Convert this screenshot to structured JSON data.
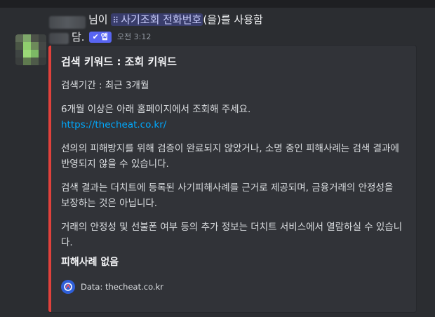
{
  "message": {
    "line1_prefix": "님이",
    "command_icon": "⠿",
    "command_name": "사기조회 전화번호",
    "line1_suffix": "(을)를 사용함",
    "author_suffix": "담.",
    "app_badge": "앱",
    "timestamp": "오전 3:12"
  },
  "embed": {
    "accent_color": "#e0413c",
    "title": "검색 키워드 : 조회 키워드",
    "search_period": "검색기간 : 최근 3개월",
    "notice_line": "6개월 이상은 아래 홈페이지에서 조회해 주세요.",
    "link": "https://thecheat.co.kr/",
    "para1": "선의의 피해방지를 위해 검증이 완료되지 않았거나, 소명 중인 피해사례는 검색 결과에 반영되지 않을 수 있습니다.",
    "para2": "검색 결과는 더치트에 등록된 사기피해사례를 근거로 제공되며, 금융거래의 안정성을 보장하는 것은 아닙니다.",
    "para3": "거래의 안정성 및 선불폰 여부 등의 추가 정보는 더치트 서비스에서 열람하실 수 있습니다.",
    "result_label": "피해사례 없음",
    "footer_text": "Data: thecheat.co.kr",
    "footer_icon": "thecheat-logo-icon"
  }
}
